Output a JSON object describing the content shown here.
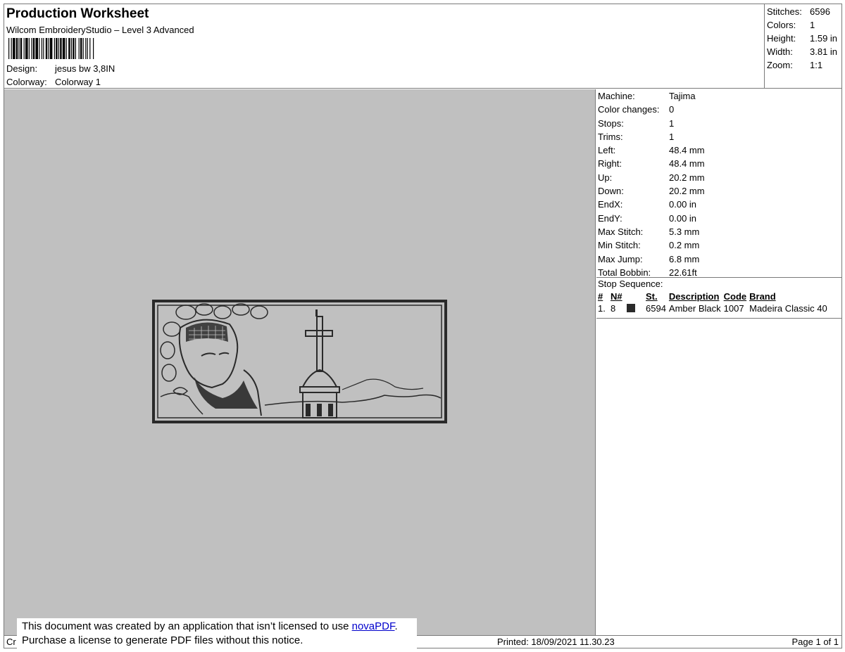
{
  "header": {
    "title": "Production Worksheet",
    "software": "Wilcom EmbroideryStudio – Level 3 Advanced",
    "design_label": "Design:",
    "design_value": "jesus bw 3,8IN",
    "colorway_label": "Colorway:",
    "colorway_value": "Colorway 1"
  },
  "summary": [
    {
      "label": "Stitches:",
      "value": "6596"
    },
    {
      "label": "Colors:",
      "value": "1"
    },
    {
      "label": "Height:",
      "value": "1.59 in"
    },
    {
      "label": "Width:",
      "value": "3.81 in"
    },
    {
      "label": "Zoom:",
      "value": "1:1"
    }
  ],
  "machine_info": [
    {
      "label": "Machine:",
      "value": "Tajima"
    },
    {
      "label": "Color changes:",
      "value": "0"
    },
    {
      "label": "Stops:",
      "value": "1"
    },
    {
      "label": "Trims:",
      "value": "1"
    },
    {
      "label": "Left:",
      "value": "48.4 mm"
    },
    {
      "label": "Right:",
      "value": "48.4 mm"
    },
    {
      "label": "Up:",
      "value": "20.2 mm"
    },
    {
      "label": "Down:",
      "value": "20.2 mm"
    },
    {
      "label": "EndX:",
      "value": "0.00 in"
    },
    {
      "label": "EndY:",
      "value": "0.00 in"
    },
    {
      "label": "Max Stitch:",
      "value": "5.3 mm"
    },
    {
      "label": "Min Stitch:",
      "value": "0.2 mm"
    },
    {
      "label": "Max Jump:",
      "value": "6.8 mm"
    },
    {
      "label": "Total Bobbin:",
      "value": "22.61ft"
    }
  ],
  "stop_sequence": {
    "title": "Stop Sequence:",
    "headers": [
      "#",
      "N#",
      "St.",
      "Description",
      "Code",
      "Brand"
    ],
    "rows": [
      {
        "index": "1.",
        "needle": "8",
        "swatch_color": "#2a2a2a",
        "stitches": "6594",
        "description": "Amber Black",
        "code": "1007",
        "brand": "Madeira Classic 40"
      }
    ]
  },
  "footer": {
    "created": "Cr",
    "printed": "Printed: 18/09/2021 11.30.23",
    "page": "Page 1 of 1"
  },
  "notice": {
    "line1_prefix": "This document was created by an application that isn’t licensed to use ",
    "link_text": "novaPDF",
    "line1_suffix": ".",
    "line2": "Purchase a license to generate PDF files without this notice."
  },
  "colors": {
    "canvas_bg": "#c0c0c0",
    "thread": "#2a2a2a",
    "border": "#7a7a7a"
  }
}
